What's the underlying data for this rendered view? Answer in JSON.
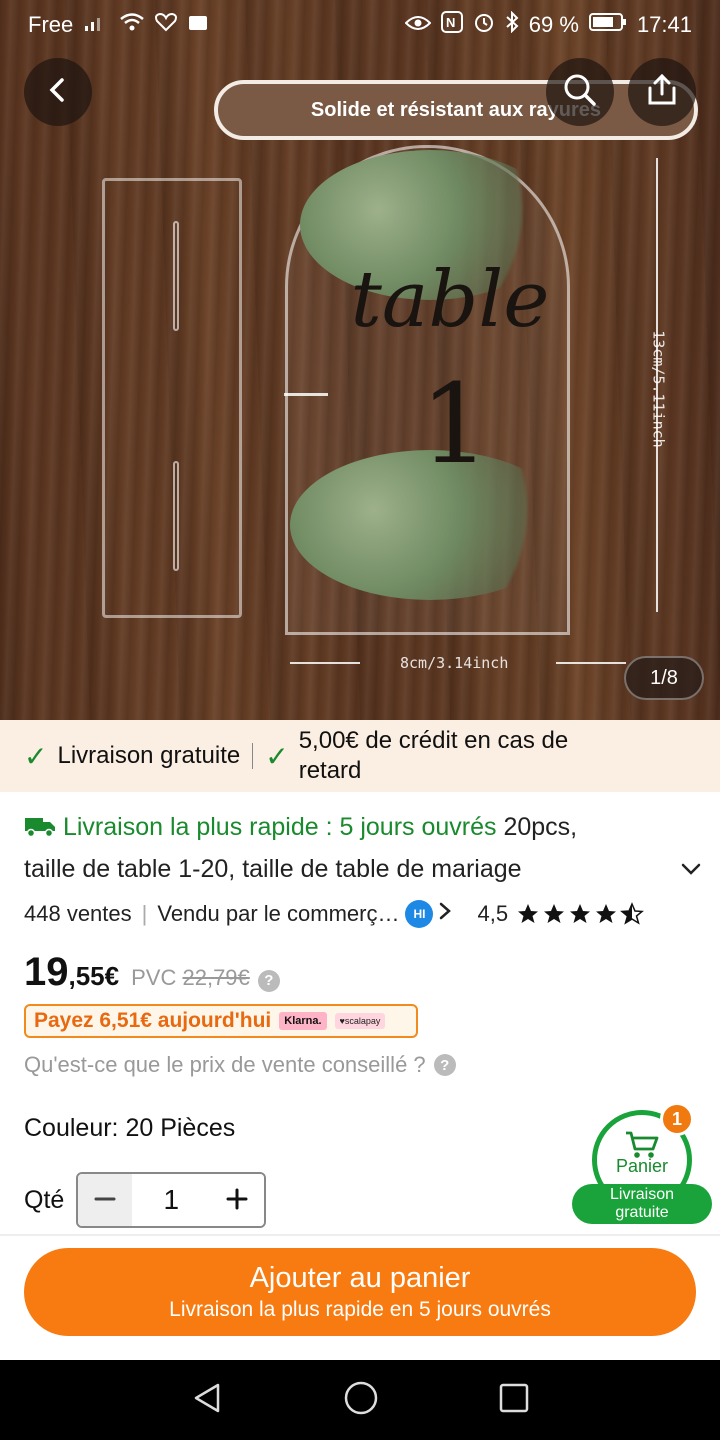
{
  "status_bar": {
    "carrier": "Free",
    "battery": "69 %",
    "time": "17:41"
  },
  "hero": {
    "banner_text": "Solide et résistant aux rayures",
    "table_word": "table",
    "table_number": "1",
    "height_label": "13cm/5.11inch",
    "width_label": "8cm/3.14inch",
    "image_counter": "1/8"
  },
  "delivery_strip": {
    "free_shipping": "Livraison gratuite",
    "credit_line1": "5,00€ de crédit en cas de",
    "credit_line2": "retard"
  },
  "product": {
    "fast_delivery": "Livraison la plus rapide : 5 jours ouvrés",
    "title_part1": " 20pcs,",
    "title_part2": "taille de table 1-20, taille de table de mariage",
    "sales": "448 ventes",
    "seller": "Vendu par le commerç…",
    "seller_badge": "HI",
    "rating": "4,5"
  },
  "price": {
    "main": "19",
    "cents": ",55€",
    "pvc_label": "PVC",
    "pvc_value": "22,79€",
    "pay_today": "Payez 6,51€ aujourd'hui",
    "klarna": "Klarna.",
    "scalapay": "♥scalapay",
    "pvc_question": "Qu'est-ce que le prix de vente conseillé ?"
  },
  "options": {
    "color_label": "Couleur: 20 Pièces",
    "qty_label": "Qté",
    "qty_value": "1"
  },
  "cart_widget": {
    "label": "Panier",
    "badge": "1",
    "pill_line1": "Livraison",
    "pill_line2": "gratuite"
  },
  "cta": {
    "main": "Ajouter au panier",
    "sub": "Livraison la plus rapide en 5 jours ouvrés"
  },
  "colors": {
    "accent": "#f77b11",
    "green": "#1a8a2e"
  }
}
